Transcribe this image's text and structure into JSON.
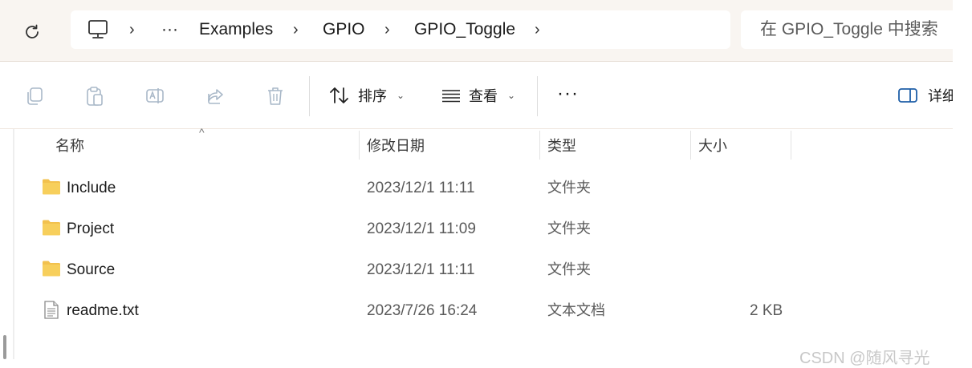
{
  "breadcrumb": {
    "overflow": "···",
    "items": [
      "Examples",
      "GPIO",
      "GPIO_Toggle"
    ]
  },
  "search": {
    "placeholder": "在 GPIO_Toggle 中搜索"
  },
  "toolbar": {
    "icons": [
      "copy-icon",
      "paste-icon",
      "rename-icon",
      "share-icon",
      "delete-icon"
    ],
    "sort_label": "排序",
    "view_label": "查看",
    "more_label": "···",
    "details_label": "详细信息"
  },
  "columns": {
    "name": "名称",
    "date": "修改日期",
    "type": "类型",
    "size": "大小"
  },
  "files": [
    {
      "name": "Include",
      "date": "2023/12/1 11:11",
      "type": "文件夹",
      "size": "",
      "icon": "folder-icon"
    },
    {
      "name": "Project",
      "date": "2023/12/1 11:09",
      "type": "文件夹",
      "size": "",
      "icon": "folder-icon"
    },
    {
      "name": "Source",
      "date": "2023/12/1 11:11",
      "type": "文件夹",
      "size": "",
      "icon": "folder-icon"
    },
    {
      "name": "readme.txt",
      "date": "2023/7/26 16:24",
      "type": "文本文档",
      "size": "2 KB",
      "icon": "text-file-icon"
    }
  ],
  "watermark": "CSDN @随风寻光",
  "colors": {
    "folder": "#f2c14e",
    "address_band": "#f9f5f1",
    "muted_text": "#5a5a5a"
  }
}
